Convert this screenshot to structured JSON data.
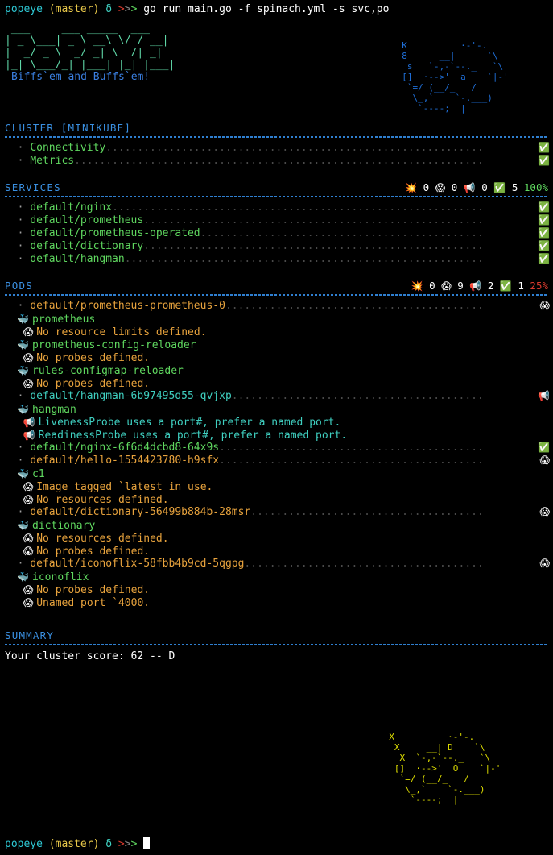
{
  "terminal": {
    "prompt": {
      "user": "popeye",
      "branch": "(master)",
      "delta": "δ",
      "caret": ">>>"
    },
    "command": "go run main.go -f spinach.yml -s svc,po",
    "bottom_prompt": {
      "user": "popeye",
      "branch": "(master)",
      "delta": "δ",
      "caret": ">>>"
    }
  },
  "banner": {
    "logo_lines": [
      " ___     ___ _____  ___ ",
      "| _ \\___| _ \\ __\\ \\/ / __|",
      "|  _/ _ \\  _/ _| \\  /| _| ",
      "|_| \\___/_| |___| |_| |___|"
    ],
    "tagline": "Biffs`em and Buffs`em!",
    "k8s_art": [
      "  K          ·-'-.",
      "  8      __|      `\\",
      "   s   `-,-`--._   `\\",
      "  []  ·-->'  a    `|-'",
      "   `=/ (__/_   /",
      "    \\_,`    `-.___)",
      "     `----;  |"
    ],
    "score_art": [
      "  X          ·-'-.",
      "   X     __| D    `\\",
      "    X  `-,-`--._   `\\",
      "   []  ·-->'  O    `|-'",
      "    `=/ (__/_   /",
      "     \\_,`    `-.___)",
      "      `----;  |"
    ]
  },
  "sections": [
    {
      "id": "cluster",
      "title": "CLUSTER [MINIKUBE]",
      "has_scores": false,
      "scores": null,
      "entries": [
        {
          "name": "Connectivity",
          "level": "ok",
          "icon": "check-box-icon",
          "children": []
        },
        {
          "name": "Metrics",
          "level": "ok",
          "icon": "check-box-icon",
          "children": []
        }
      ]
    },
    {
      "id": "services",
      "title": "SERVICES",
      "has_scores": true,
      "scores": {
        "error_icon": "💥",
        "error_count": "0",
        "warn_icon": "😱",
        "warn_count": "0",
        "info_icon": "📢",
        "info_count": "0",
        "ok_icon": "✅",
        "ok_count": "5",
        "percent": "100%",
        "percent_color": "#5fd75f"
      },
      "entries": [
        {
          "name": "default/nginx",
          "level": "ok",
          "icon": "check-box-icon",
          "children": []
        },
        {
          "name": "default/prometheus",
          "level": "ok",
          "icon": "check-box-icon",
          "children": []
        },
        {
          "name": "default/prometheus-operated",
          "level": "ok",
          "icon": "check-box-icon",
          "children": []
        },
        {
          "name": "default/dictionary",
          "level": "ok",
          "icon": "check-box-icon",
          "children": []
        },
        {
          "name": "default/hangman",
          "level": "ok",
          "icon": "check-box-icon",
          "children": []
        }
      ]
    },
    {
      "id": "pods",
      "title": "PODS",
      "has_scores": true,
      "scores": {
        "error_icon": "💥",
        "error_count": "0",
        "warn_icon": "😱",
        "warn_count": "9",
        "info_icon": "📢",
        "info_count": "2",
        "ok_icon": "✅",
        "ok_count": "1",
        "percent": "25%",
        "percent_color": "#d83a2e"
      },
      "entries": [
        {
          "name": "default/prometheus-prometheus-0",
          "level": "warn",
          "icon": "scream-icon",
          "children": [
            {
              "container": "prometheus",
              "container_icon": "🐳",
              "issues": [
                {
                  "icon": "😱",
                  "level": "warn",
                  "text": "No resource limits defined."
                }
              ]
            },
            {
              "container": "prometheus-config-reloader",
              "container_icon": "🐳",
              "issues": [
                {
                  "icon": "😱",
                  "level": "warn",
                  "text": "No probes defined."
                }
              ]
            },
            {
              "container": "rules-configmap-reloader",
              "container_icon": "🐳",
              "issues": [
                {
                  "icon": "😱",
                  "level": "warn",
                  "text": "No probes defined."
                }
              ]
            }
          ]
        },
        {
          "name": "default/hangman-6b97495d55-qvjxp",
          "level": "info",
          "icon": "megaphone-icon",
          "children": [
            {
              "container": "hangman",
              "container_icon": "🐳",
              "issues": [
                {
                  "icon": "📢",
                  "level": "info",
                  "text": "LivenessProbe uses a port#, prefer a named port."
                },
                {
                  "icon": "📢",
                  "level": "info",
                  "text": "ReadinessProbe uses a port#, prefer a named port."
                }
              ]
            }
          ]
        },
        {
          "name": "default/nginx-6f6d4dcbd8-64x9s",
          "level": "ok",
          "icon": "check-box-icon",
          "children": []
        },
        {
          "name": "default/hello-1554423780-h9sfx",
          "level": "warn",
          "icon": "scream-icon",
          "children": [
            {
              "container": "c1",
              "container_icon": "🐳",
              "issues": [
                {
                  "icon": "😱",
                  "level": "warn",
                  "text": "Image tagged `latest in use."
                },
                {
                  "icon": "😱",
                  "level": "warn",
                  "text": "No resources defined."
                }
              ]
            }
          ]
        },
        {
          "name": "default/dictionary-56499b884b-28msr",
          "level": "warn",
          "icon": "scream-icon",
          "children": [
            {
              "container": "dictionary",
              "container_icon": "🐳",
              "issues": [
                {
                  "icon": "😱",
                  "level": "warn",
                  "text": "No resources defined."
                },
                {
                  "icon": "😱",
                  "level": "warn",
                  "text": "No probes defined."
                }
              ]
            }
          ]
        },
        {
          "name": "default/iconoflix-58fbb4b9cd-5qgpg",
          "level": "warn",
          "icon": "scream-icon",
          "children": [
            {
              "container": "iconoflix",
              "container_icon": "🐳",
              "issues": [
                {
                  "icon": "😱",
                  "level": "warn",
                  "text": "No probes defined."
                },
                {
                  "icon": "😱",
                  "level": "warn",
                  "text": "Unamed port `4000."
                }
              ]
            }
          ]
        }
      ]
    }
  ],
  "summary": {
    "title": "SUMMARY",
    "score_text": "Your cluster score: 62 -- D"
  },
  "colors": {
    "ok": "#5fd75f",
    "warn": "#e8a33d",
    "info": "#3fcfc0",
    "error": "#d83a2e",
    "header": "#3a8fe0",
    "dots": "#4a4a4a"
  }
}
